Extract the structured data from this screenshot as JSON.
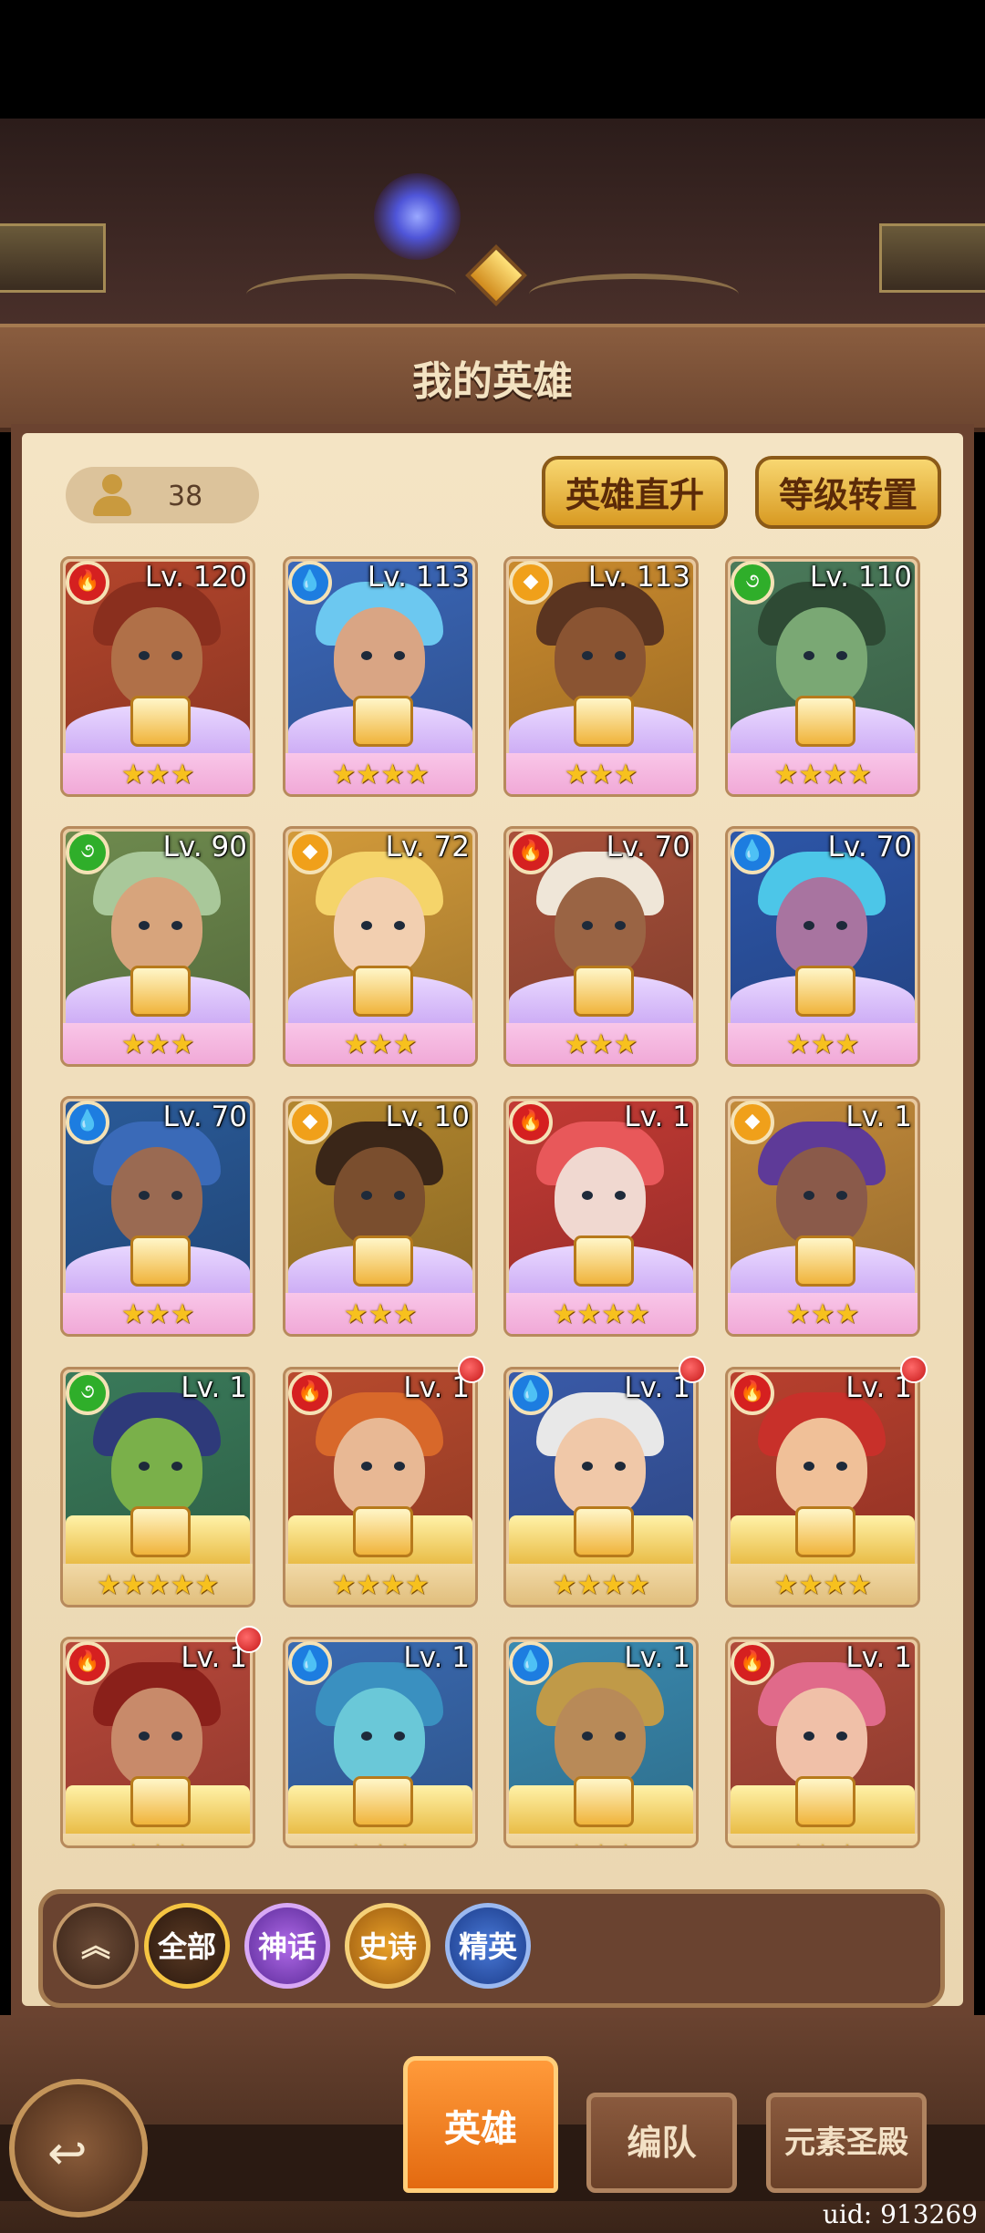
{
  "header": {
    "title": "我的英雄"
  },
  "hero_count": "38",
  "buttons": {
    "direct_upgrade": "英雄直升",
    "level_transfer": "等级转置"
  },
  "elements": {
    "fire": {
      "color": "#d52020",
      "glyph": "🔥"
    },
    "water": {
      "color": "#1d7de0",
      "glyph": "💧"
    },
    "light": {
      "color": "#f0a01a",
      "glyph": "◆"
    },
    "wind": {
      "color": "#2fae2a",
      "glyph": "૭"
    }
  },
  "heroes": [
    {
      "level": "Lv. 120",
      "element": "fire",
      "rarity": "myth",
      "stars": "★★★",
      "bg": "#b3452c",
      "skin": "#b07048",
      "hair": "#8a2f1e",
      "dot": false
    },
    {
      "level": "Lv. 113",
      "element": "water",
      "rarity": "myth",
      "stars": "★★★★",
      "bg": "#3b67b8",
      "skin": "#d9a584",
      "hair": "#6cc8f0",
      "dot": false
    },
    {
      "level": "Lv. 113",
      "element": "light",
      "rarity": "myth",
      "stars": "★★★",
      "bg": "#c98a2e",
      "skin": "#8a5432",
      "hair": "#5a3420",
      "dot": false
    },
    {
      "level": "Lv. 110",
      "element": "wind",
      "rarity": "myth",
      "stars": "★★★★",
      "bg": "#4a7a5a",
      "skin": "#7aa874",
      "hair": "#2e4a34",
      "dot": false
    },
    {
      "level": "Lv. 90",
      "element": "wind",
      "rarity": "myth",
      "stars": "★★★",
      "bg": "#6e8a4e",
      "skin": "#d7a47c",
      "hair": "#a9c89a",
      "dot": false
    },
    {
      "level": "Lv. 72",
      "element": "light",
      "rarity": "myth",
      "stars": "★★★",
      "bg": "#d29a3a",
      "skin": "#f2cfb0",
      "hair": "#f5d46a",
      "dot": false
    },
    {
      "level": "Lv. 70",
      "element": "fire",
      "rarity": "myth",
      "stars": "★★★",
      "bg": "#a8503a",
      "skin": "#9a6444",
      "hair": "#efe6d8",
      "dot": false
    },
    {
      "level": "Lv. 70",
      "element": "water",
      "rarity": "myth",
      "stars": "★★★",
      "bg": "#2d56a8",
      "skin": "#a874a0",
      "hair": "#4cc6e8",
      "dot": false
    },
    {
      "level": "Lv. 70",
      "element": "water",
      "rarity": "myth",
      "stars": "★★★",
      "bg": "#2a5a98",
      "skin": "#9a6a52",
      "hair": "#3a6ab8",
      "dot": false
    },
    {
      "level": "Lv. 10",
      "element": "light",
      "rarity": "myth",
      "stars": "★★★",
      "bg": "#b2862e",
      "skin": "#7a4e2e",
      "hair": "#3a2618",
      "dot": false
    },
    {
      "level": "Lv. 1",
      "element": "fire",
      "rarity": "myth",
      "stars": "★★★★",
      "bg": "#c23a34",
      "skin": "#f0d8d0",
      "hair": "#e8585a",
      "dot": false
    },
    {
      "level": "Lv. 1",
      "element": "light",
      "rarity": "myth",
      "stars": "★★★",
      "bg": "#c28a3a",
      "skin": "#8a5a4a",
      "hair": "#5e3a98",
      "dot": false
    },
    {
      "level": "Lv. 1",
      "element": "wind",
      "rarity": "epic",
      "stars": "★★★★★",
      "bg": "#3a7a5a",
      "skin": "#7ab04a",
      "hair": "#2e3a7a",
      "dot": false
    },
    {
      "level": "Lv. 1",
      "element": "fire",
      "rarity": "epic",
      "stars": "★★★★",
      "bg": "#b84a2e",
      "skin": "#e8b894",
      "hair": "#d8682a",
      "dot": true
    },
    {
      "level": "Lv. 1",
      "element": "water",
      "rarity": "epic",
      "stars": "★★★★",
      "bg": "#3a5aa8",
      "skin": "#f0c8a8",
      "hair": "#e8e8e8",
      "dot": true
    },
    {
      "level": "Lv. 1",
      "element": "fire",
      "rarity": "epic",
      "stars": "★★★★",
      "bg": "#b8402e",
      "skin": "#f0c098",
      "hair": "#c8302a",
      "dot": true
    },
    {
      "level": "Lv. 1",
      "element": "fire",
      "rarity": "epic",
      "stars": "★★★",
      "bg": "#b8483a",
      "skin": "#c88a6a",
      "hair": "#8a201a",
      "dot": true
    },
    {
      "level": "Lv. 1",
      "element": "water",
      "rarity": "epic",
      "stars": "★★★",
      "bg": "#3a6ab0",
      "skin": "#6ac8d8",
      "hair": "#3a90c0",
      "dot": false
    },
    {
      "level": "Lv. 1",
      "element": "water",
      "rarity": "epic",
      "stars": "★★★",
      "bg": "#3a8ab0",
      "skin": "#b88a58",
      "hair": "#c09a48",
      "dot": false
    },
    {
      "level": "Lv. 1",
      "element": "fire",
      "rarity": "epic",
      "stars": "★★★",
      "bg": "#b04a3a",
      "skin": "#f0c0a8",
      "hair": "#e06a8a",
      "dot": false
    }
  ],
  "filters": {
    "all": "全部",
    "myth": "神话",
    "epic": "史诗",
    "elite": "精英",
    "colors": {
      "all": "#f5c542",
      "myth": "#b06ae8",
      "epic": "#e8a028",
      "elite": "#4a7ad8"
    }
  },
  "tabs": {
    "heroes": "英雄",
    "formation": "编队",
    "shrine": "元素圣殿"
  },
  "uid": "uid: 913269"
}
